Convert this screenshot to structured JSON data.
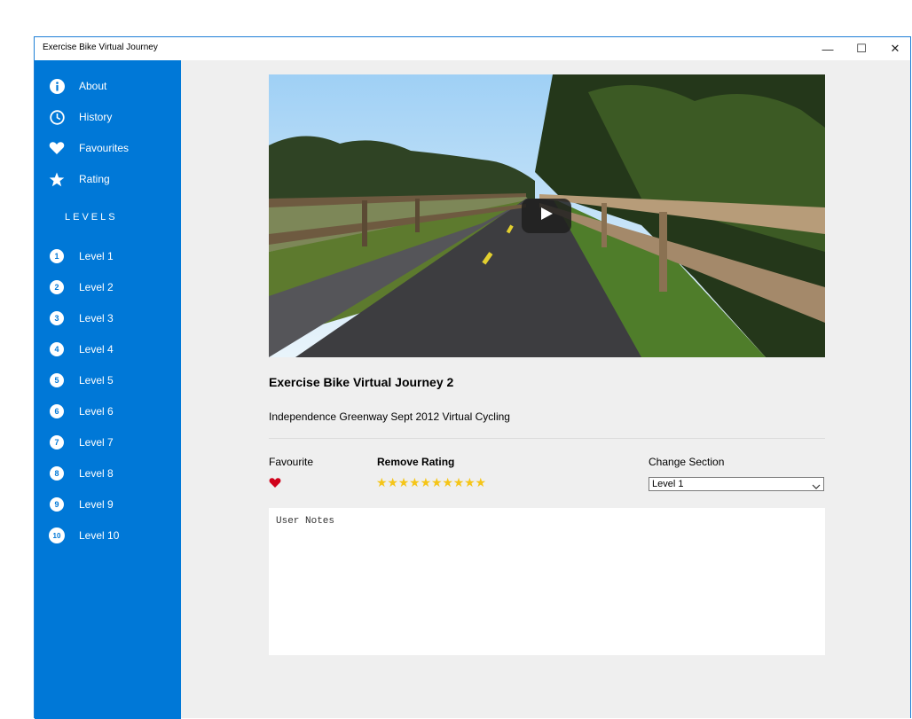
{
  "window": {
    "title": "Exercise Bike Virtual Journey",
    "minimize": "—",
    "maximize": "☐",
    "close": "✕"
  },
  "sidebar": {
    "menu": [
      {
        "label": "About",
        "icon": "info-icon"
      },
      {
        "label": "History",
        "icon": "clock-icon"
      },
      {
        "label": "Favourites",
        "icon": "heart-icon"
      },
      {
        "label": "Rating",
        "icon": "star-icon"
      }
    ],
    "levels_heading": "LEVELS",
    "levels": [
      {
        "num": "1",
        "label": "Level 1"
      },
      {
        "num": "2",
        "label": "Level 2"
      },
      {
        "num": "3",
        "label": "Level 3"
      },
      {
        "num": "4",
        "label": "Level 4"
      },
      {
        "num": "5",
        "label": "Level 5"
      },
      {
        "num": "6",
        "label": "Level 6"
      },
      {
        "num": "7",
        "label": "Level 7"
      },
      {
        "num": "8",
        "label": "Level 8"
      },
      {
        "num": "9",
        "label": "Level 9"
      },
      {
        "num": "10",
        "label": "Level 10"
      }
    ]
  },
  "main": {
    "video": {
      "play_icon": "play-icon"
    },
    "title": "Exercise Bike Virtual Journey 2",
    "description": "Independence Greenway Sept 2012 Virtual Cycling",
    "favourite_label": "Favourite",
    "favourite_active": true,
    "rating_label": "Remove Rating",
    "rating": {
      "value": 10,
      "max": 10
    },
    "section_label": "Change Section",
    "section_value": "Level 1",
    "notes_placeholder": "User Notes"
  },
  "colors": {
    "sidebar_bg": "#0078d7",
    "star": "#f5c518",
    "heart": "#d0021b",
    "window_border": "#1e7fd6"
  }
}
